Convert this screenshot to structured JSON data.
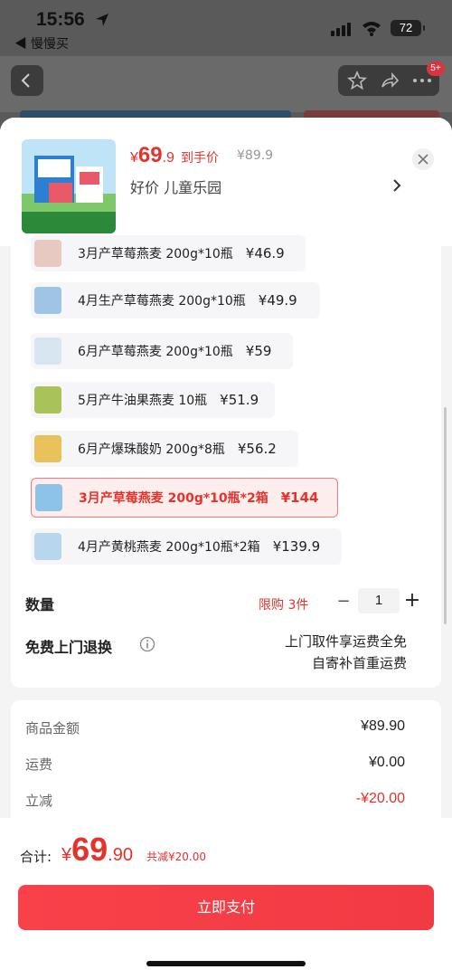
{
  "status": {
    "time": "15:56",
    "back_app": "◀ 慢慢买",
    "battery": "72",
    "badge": "5+"
  },
  "product": {
    "price_currency": "¥",
    "price_int": "69",
    "price_dec": ".9",
    "price_tag": "到手价",
    "original_price": "¥89.9",
    "selection_label": "好价  儿童乐园"
  },
  "options": [
    {
      "name": "3月产草莓燕麦 200g*10瓶",
      "price": "¥46.9",
      "thumb": "#e8c9c2",
      "selected": false
    },
    {
      "name": "4月生产草莓燕麦 200g*10瓶",
      "price": "¥49.9",
      "thumb": "#9fc4e6",
      "selected": false
    },
    {
      "name": "6月产草莓燕麦 200g*10瓶",
      "price": "¥59",
      "thumb": "#d8e6f2",
      "selected": false
    },
    {
      "name": "5月产牛油果燕麦 10瓶",
      "price": "¥51.9",
      "thumb": "#a9c25a",
      "selected": false
    },
    {
      "name": "6月产爆珠酸奶 200g*8瓶",
      "price": "¥56.2",
      "thumb": "#e8c25a",
      "selected": false
    },
    {
      "name": "3月产草莓燕麦 200g*10瓶*2箱",
      "price": "¥144",
      "thumb": "#8ec3e8",
      "selected": true
    },
    {
      "name": "4月产黄桃燕麦 200g*10瓶*2箱",
      "price": "¥139.9",
      "thumb": "#b9d6ef",
      "selected": false
    }
  ],
  "quantity": {
    "label": "数量",
    "limit": "限购 3件",
    "minus": "−",
    "value": "1",
    "plus": "+"
  },
  "return_service": {
    "label": "免费上门退换",
    "line1": "上门取件享运费全免",
    "line2": "自寄补首重运费"
  },
  "costs": [
    {
      "label": "商品金额",
      "value": "¥89.90"
    },
    {
      "label": "运费",
      "value": "¥0.00"
    },
    {
      "label": "立减",
      "value": "-¥20.00"
    }
  ],
  "footer": {
    "total_label": "合计:",
    "total_currency": "¥",
    "total_int": "69",
    "total_dec": ".90",
    "saved": "共减¥20.00",
    "pay_button": "立即支付"
  },
  "colors": {
    "accent": "#e5322d",
    "pay_button": "#f23a44"
  }
}
